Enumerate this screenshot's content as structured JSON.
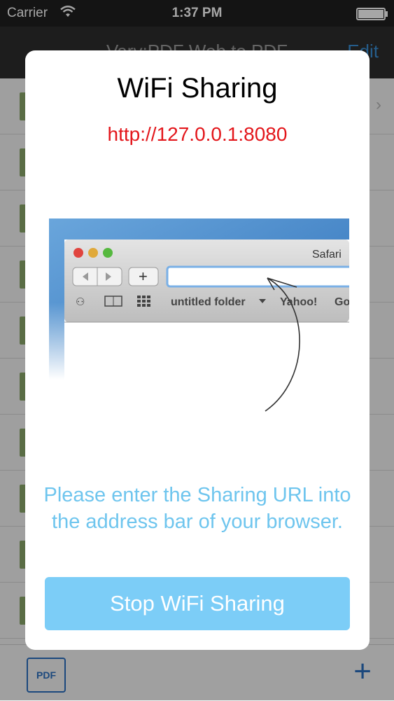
{
  "status_bar": {
    "carrier": "Carrier",
    "time": "1:37 PM"
  },
  "nav": {
    "title": "Vary:PDF Web to PDF",
    "edit_label": "Edit"
  },
  "modal": {
    "title": "WiFi Sharing",
    "url": "http://127.0.0.1:8080",
    "instructions": "Please enter the Sharing URL into the address bar of your browser.",
    "stop_button_label": "Stop WiFi Sharing"
  },
  "illustration": {
    "window_title": "Safari",
    "bookmark_folder": "untitled folder",
    "bookmark_yahoo": "Yahoo!",
    "bookmark_partial": "Go"
  },
  "toolbar": {
    "pdf_label": "PDF",
    "add_icon": "plus-icon"
  },
  "colors": {
    "url": "#e3161b",
    "instructions": "#6ec5ee",
    "button": "#7ccdf7"
  }
}
